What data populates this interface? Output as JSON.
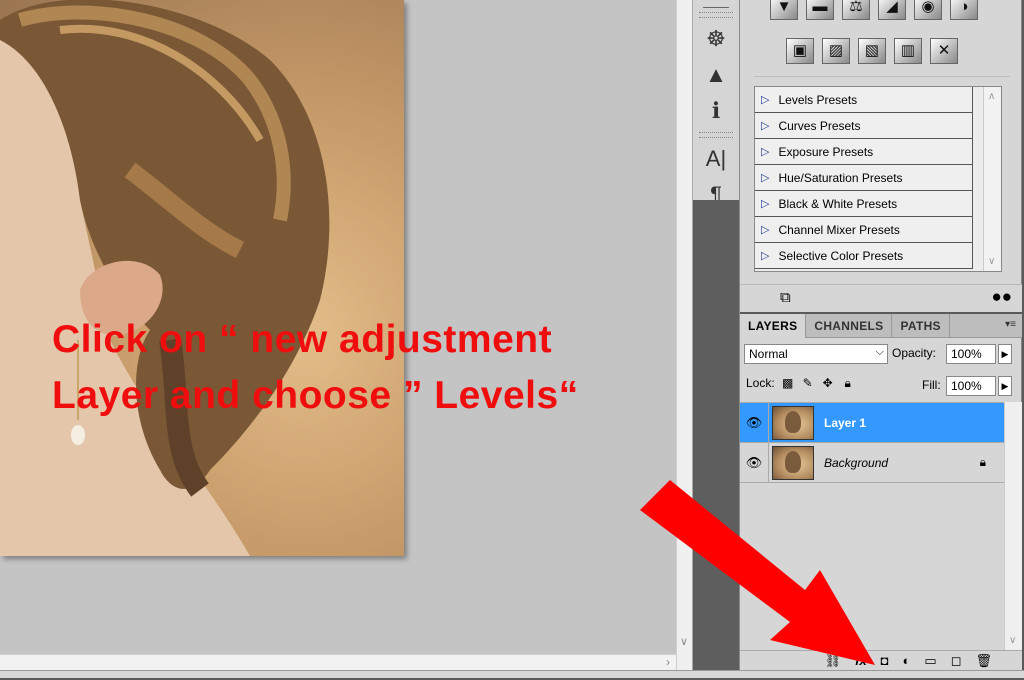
{
  "instruction": {
    "text": "Click on “ new adjustment\nLayer and choose ” Levels“",
    "color": "#f00d0d"
  },
  "icon_strip": {
    "icons": [
      "adjustments-icon",
      "navigator-icon",
      "histogram-icon",
      "info-icon",
      "character-icon",
      "paragraph-icon"
    ],
    "glyphs": [
      "☸",
      "▲",
      "ℹ",
      "A|",
      "¶"
    ]
  },
  "adjustments": {
    "row1_glyphs": [
      "▼",
      "▬",
      "⚖",
      "◢",
      "◉",
      "◑"
    ],
    "row2_glyphs": [
      "▣",
      "▨",
      "▧",
      "▥",
      "✕"
    ],
    "presets": [
      "Levels Presets",
      "Curves Presets",
      "Exposure Presets",
      "Hue/Saturation Presets",
      "Black & White Presets",
      "Channel Mixer Presets",
      "Selective Color Presets"
    ]
  },
  "layers_panel": {
    "tabs": [
      "LAYERS",
      "CHANNELS",
      "PATHS"
    ],
    "blend_mode": "Normal",
    "opacity_label": "Opacity:",
    "opacity_value": "100%",
    "lock_label": "Lock:",
    "fill_label": "Fill:",
    "fill_value": "100%",
    "layers": [
      {
        "name": "Layer 1",
        "selected": true
      },
      {
        "name": "Background",
        "selected": false,
        "locked": true
      }
    ],
    "footer_icons": [
      "link-icon",
      "fx-icon",
      "mask-icon",
      "new-adjustment-layer-icon",
      "group-icon",
      "new-layer-icon",
      "trash-icon"
    ],
    "footer_glyphs": [
      "⛓",
      "fx",
      "◘",
      "◐",
      "▭",
      "◻",
      "🗑"
    ]
  },
  "colors": {
    "selection": "#3399ff",
    "panel_bg": "#d6d6d6",
    "canvas_bg": "#c4c4c4",
    "arrow": "#ff0000"
  }
}
